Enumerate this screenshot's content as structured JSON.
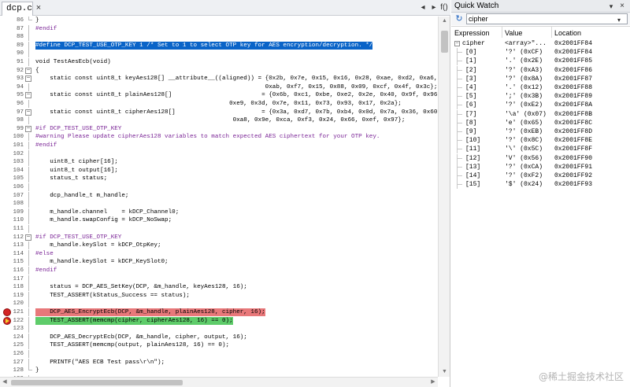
{
  "editor": {
    "tab_label": "dcp.c",
    "tab_close": "×",
    "toolbar_left_arrow": "◂",
    "toolbar_right_arrow": "▸",
    "toolbar_function_icon": "f()",
    "lines": [
      {
        "n": "86",
        "text": "}",
        "fold": "end"
      },
      {
        "n": "87",
        "text": "#endif",
        "pp": true
      },
      {
        "n": "88",
        "text": ""
      },
      {
        "n": "89",
        "text": "#define DCP_TEST_USE_OTP_KEY 1 /* Set to 1 to select OTP key for AES encryption/decryption. */",
        "style": "sel"
      },
      {
        "n": "90",
        "text": ""
      },
      {
        "n": "91",
        "text": "void TestAesEcb(void)"
      },
      {
        "n": "92",
        "text": "{",
        "fold": "open"
      },
      {
        "n": "93",
        "text": "    static const uint8_t keyAes128[] __attribute__((aligned)) = {0x2b, 0x7e, 0x15, 0x16, 0x28, 0xae, 0xd2, 0xa6,",
        "fold": "open"
      },
      {
        "n": "94",
        "text": "                                                                0xab, 0xf7, 0x15, 0x88, 0x09, 0xcf, 0x4f, 0x3c};"
      },
      {
        "n": "95",
        "text": "    static const uint8_t plainAes128[]                         = {0x6b, 0xc1, 0xbe, 0xe2, 0x2e, 0x40, 0x9f, 0x96,",
        "fold": "open"
      },
      {
        "n": "96",
        "text": "                                                      0xe9, 0x3d, 0x7e, 0x11, 0x73, 0x93, 0x17, 0x2a};"
      },
      {
        "n": "97",
        "text": "    static const uint8_t cipherAes128[]                        = {0x3a, 0xd7, 0x7b, 0xb4, 0x0d, 0x7a, 0x36, 0x60,",
        "fold": "open"
      },
      {
        "n": "98",
        "text": "                                                       0xa8, 0x9e, 0xca, 0xf3, 0x24, 0x66, 0xef, 0x97};"
      },
      {
        "n": "99",
        "text": "#if DCP_TEST_USE_OTP_KEY",
        "pp": true,
        "fold": "open"
      },
      {
        "n": "100",
        "text": "#warning Please update cipherAes128 variables to match expected AES ciphertext for your OTP key.",
        "pp": true
      },
      {
        "n": "101",
        "text": "#endif",
        "pp": true
      },
      {
        "n": "102",
        "text": ""
      },
      {
        "n": "103",
        "text": "    uint8_t cipher[16];"
      },
      {
        "n": "104",
        "text": "    uint8_t output[16];"
      },
      {
        "n": "105",
        "text": "    status_t status;"
      },
      {
        "n": "106",
        "text": ""
      },
      {
        "n": "107",
        "text": "    dcp_handle_t m_handle;"
      },
      {
        "n": "108",
        "text": ""
      },
      {
        "n": "109",
        "text": "    m_handle.channel    = kDCP_Channel0;"
      },
      {
        "n": "110",
        "text": "    m_handle.swapConfig = kDCP_NoSwap;"
      },
      {
        "n": "111",
        "text": ""
      },
      {
        "n": "112",
        "text": "#if DCP_TEST_USE_OTP_KEY",
        "pp": true,
        "fold": "open"
      },
      {
        "n": "113",
        "text": "    m_handle.keySlot = kDCP_OtpKey;"
      },
      {
        "n": "114",
        "text": "#else",
        "pp": true
      },
      {
        "n": "115",
        "text": "    m_handle.keySlot = kDCP_KeySlot0;"
      },
      {
        "n": "116",
        "text": "#endif",
        "pp": true
      },
      {
        "n": "117",
        "text": ""
      },
      {
        "n": "118",
        "text": "    status = DCP_AES_SetKey(DCP, &m_handle, keyAes128, 16);"
      },
      {
        "n": "119",
        "text": "    TEST_ASSERT(kStatus_Success == status);"
      },
      {
        "n": "120",
        "text": ""
      },
      {
        "n": "121",
        "text": "    DCP_AES_EncryptEcb(DCP, &m_handle, plainAes128, cipher, 16);",
        "style": "hl-red",
        "bp": "dot"
      },
      {
        "n": "122",
        "text": "    TEST_ASSERT(memcmp(cipher, cipherAes128, 16) == 0);",
        "style": "hl-green",
        "bp": "arrow"
      },
      {
        "n": "123",
        "text": ""
      },
      {
        "n": "124",
        "text": "    DCP_AES_DecryptEcb(DCP, &m_handle, cipher, output, 16);"
      },
      {
        "n": "125",
        "text": "    TEST_ASSERT(memcmp(output, plainAes128, 16) == 0);"
      },
      {
        "n": "126",
        "text": ""
      },
      {
        "n": "127",
        "text": "    PRINTF(\"AES ECB Test pass\\r\\n\");"
      },
      {
        "n": "128",
        "text": "}",
        "fold": "end"
      },
      {
        "n": "129",
        "text": ""
      }
    ]
  },
  "quick_watch": {
    "title": "Quick Watch",
    "close": "×",
    "pin": "▾",
    "expression_value": "cipher",
    "headers": {
      "expression": "Expression",
      "value": "Value",
      "location": "Location"
    },
    "root": {
      "expression": "cipher",
      "value": "<array>\"...",
      "location": "0x2001FF84"
    },
    "rows": [
      {
        "expression": "[0]",
        "value": "'?' (0xCF)",
        "location": "0x2001FF84"
      },
      {
        "expression": "[1]",
        "value": "'.' (0x2E)",
        "location": "0x2001FF85"
      },
      {
        "expression": "[2]",
        "value": "'?' (0xA3)",
        "location": "0x2001FF86"
      },
      {
        "expression": "[3]",
        "value": "'?' (0x8A)",
        "location": "0x2001FF87"
      },
      {
        "expression": "[4]",
        "value": "'.' (0x12)",
        "location": "0x2001FF88"
      },
      {
        "expression": "[5]",
        "value": "';' (0x3B)",
        "location": "0x2001FF89"
      },
      {
        "expression": "[6]",
        "value": "'?' (0xE2)",
        "location": "0x2001FF8A"
      },
      {
        "expression": "[7]",
        "value": "'\\a' (0x07)",
        "location": "0x2001FF8B"
      },
      {
        "expression": "[8]",
        "value": "'e' (0x65)",
        "location": "0x2001FF8C"
      },
      {
        "expression": "[9]",
        "value": "'?' (0xEB)",
        "location": "0x2001FF8D"
      },
      {
        "expression": "[10]",
        "value": "'?' (0x8C)",
        "location": "0x2001FF8E"
      },
      {
        "expression": "[11]",
        "value": "'\\' (0x5C)",
        "location": "0x2001FF8F"
      },
      {
        "expression": "[12]",
        "value": "'V' (0x56)",
        "location": "0x2001FF90"
      },
      {
        "expression": "[13]",
        "value": "'?' (0xCA)",
        "location": "0x2001FF91"
      },
      {
        "expression": "[14]",
        "value": "'?' (0xF2)",
        "location": "0x2001FF92"
      },
      {
        "expression": "[15]",
        "value": "'$' (0x24)",
        "location": "0x2001FF93"
      }
    ]
  },
  "watermark": "@稀土掘金技术社区",
  "colors": {
    "selection": "#0a64c8",
    "breakpoint_line": "#e8787a",
    "current_line": "#5ecc6a",
    "preprocessor": "#7a2496",
    "breakpoint_dot": "#d32424"
  }
}
